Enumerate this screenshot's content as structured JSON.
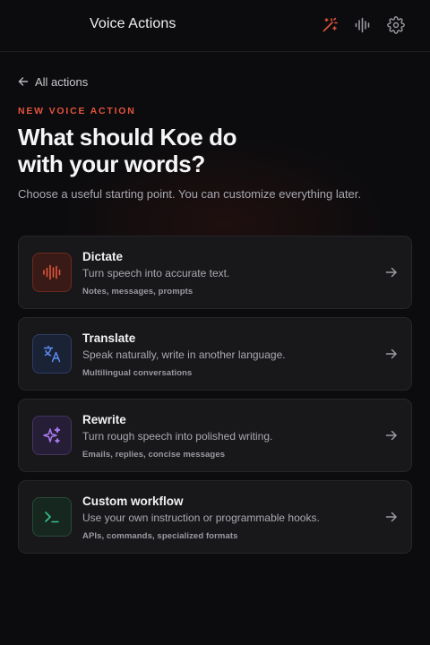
{
  "header": {
    "title": "Voice Actions",
    "icons": [
      "magic-wand-icon",
      "waveform-icon",
      "gear-icon"
    ],
    "accent": "#e3533c"
  },
  "back_link": {
    "label": "All actions",
    "icon": "arrow-left-icon"
  },
  "hero": {
    "eyebrow": "NEW VOICE ACTION",
    "headline_line1": "What should Koe do",
    "headline_line2": "with your words?",
    "subtitle": "Choose a useful starting point. You can customize everything later."
  },
  "actions": [
    {
      "title": "Dictate",
      "description": "Turn speech into accurate text.",
      "tags": "Notes, messages, prompts",
      "icon": "waveform-icon",
      "color": "#e2543c"
    },
    {
      "title": "Translate",
      "description": "Speak naturally, write in another language.",
      "tags": "Multilingual conversations",
      "icon": "translate-icon",
      "color": "#5b8def"
    },
    {
      "title": "Rewrite",
      "description": "Turn rough speech into polished writing.",
      "tags": "Emails, replies, concise messages",
      "icon": "sparkles-icon",
      "color": "#a77bef"
    },
    {
      "title": "Custom workflow",
      "description": "Use your own instruction or programmable hooks.",
      "tags": "APIs, commands, specialized formats",
      "icon": "terminal-icon",
      "color": "#36c08a"
    }
  ]
}
